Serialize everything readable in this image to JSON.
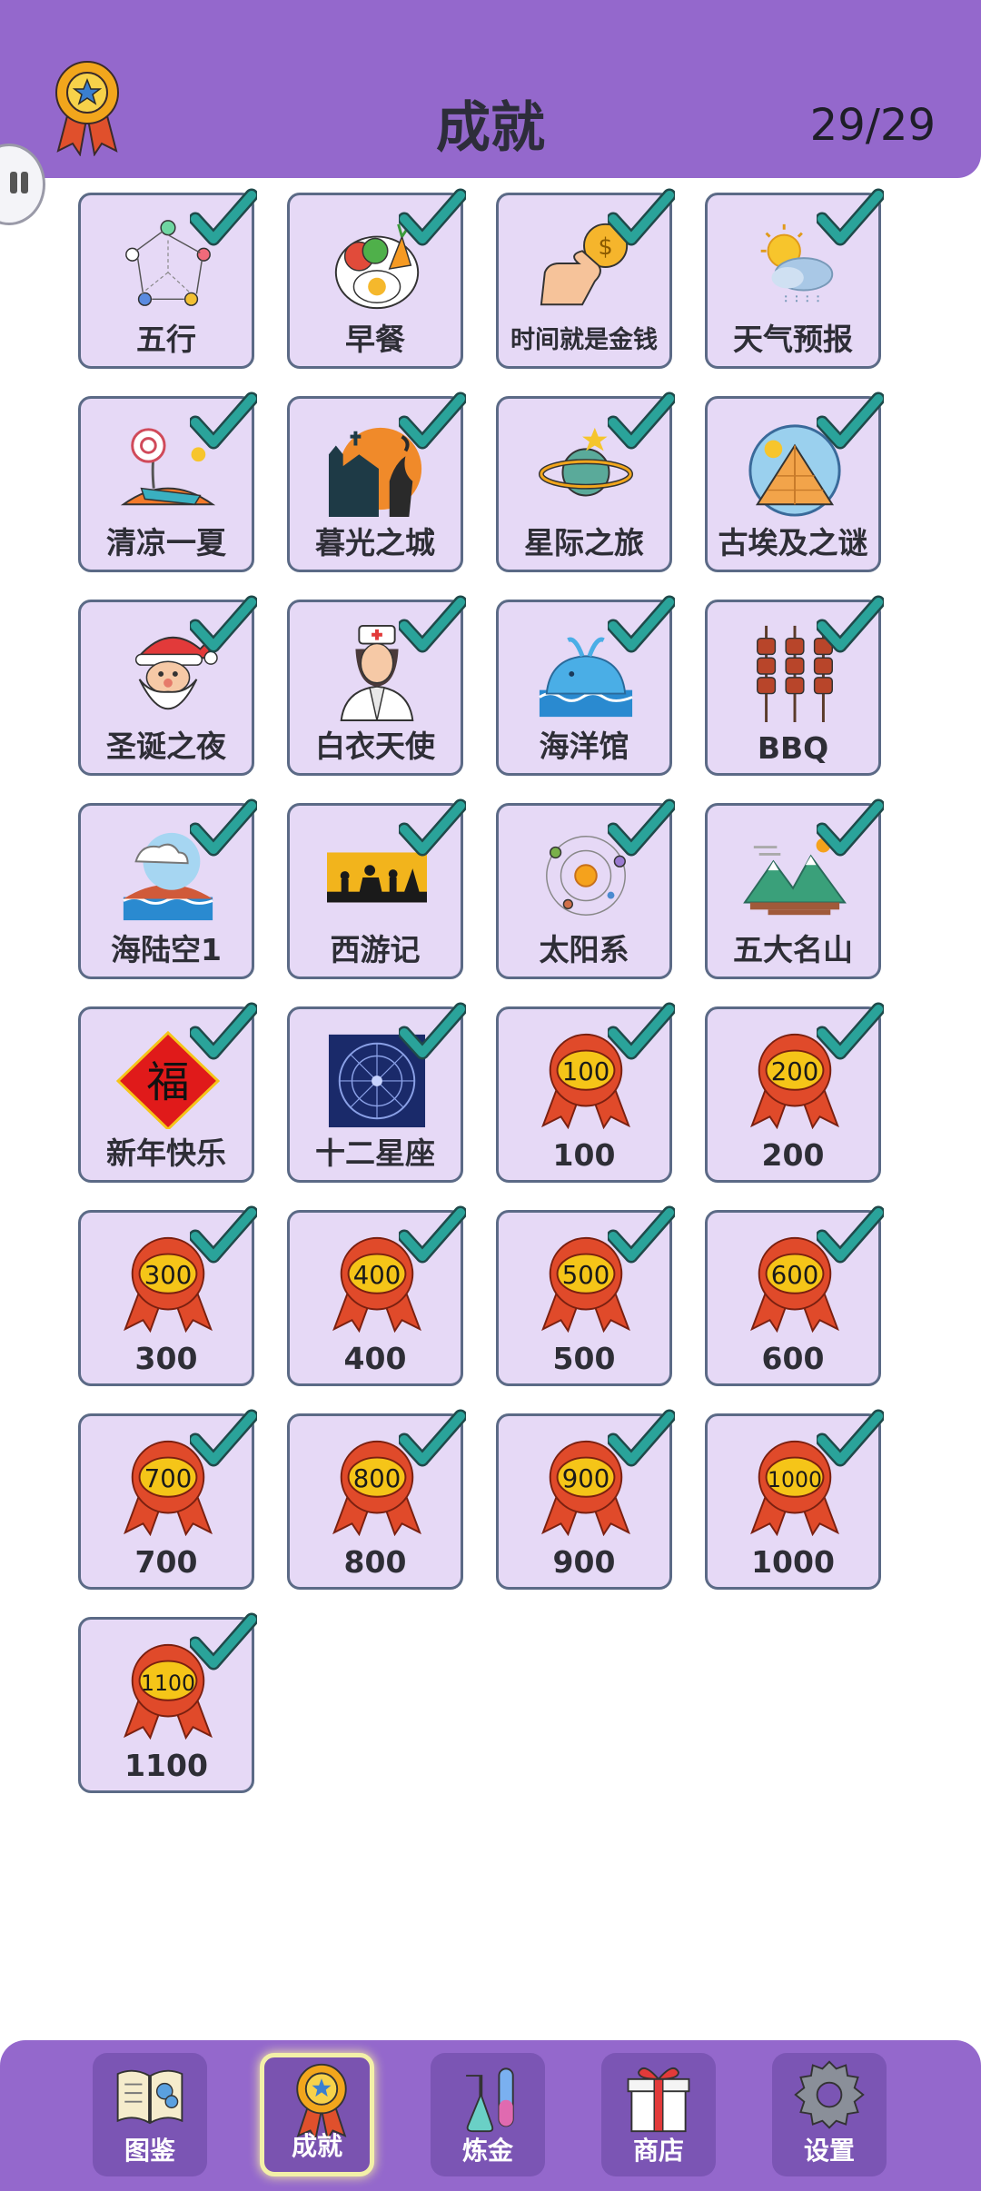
{
  "header": {
    "title": "成就",
    "count": "29/29"
  },
  "cards": [
    {
      "label": "五行"
    },
    {
      "label": "早餐"
    },
    {
      "label": "时间就是金钱"
    },
    {
      "label": "天气预报"
    },
    {
      "label": "清凉一夏"
    },
    {
      "label": "暮光之城"
    },
    {
      "label": "星际之旅"
    },
    {
      "label": "古埃及之谜"
    },
    {
      "label": "圣诞之夜"
    },
    {
      "label": "白衣天使"
    },
    {
      "label": "海洋馆"
    },
    {
      "label": "BBQ"
    },
    {
      "label": "海陆空1"
    },
    {
      "label": "西游记"
    },
    {
      "label": "太阳系"
    },
    {
      "label": "五大名山"
    },
    {
      "label": "新年快乐",
      "fu": "福"
    },
    {
      "label": "十二星座"
    },
    {
      "label": "100",
      "ribbon": "100"
    },
    {
      "label": "200",
      "ribbon": "200"
    },
    {
      "label": "300",
      "ribbon": "300"
    },
    {
      "label": "400",
      "ribbon": "400"
    },
    {
      "label": "500",
      "ribbon": "500"
    },
    {
      "label": "600",
      "ribbon": "600"
    },
    {
      "label": "700",
      "ribbon": "700"
    },
    {
      "label": "800",
      "ribbon": "800"
    },
    {
      "label": "900",
      "ribbon": "900"
    },
    {
      "label": "1000",
      "ribbon": "1000"
    },
    {
      "label": "1100",
      "ribbon": "1100"
    }
  ],
  "nav": [
    {
      "label": "图鉴",
      "icon": "book-icon"
    },
    {
      "label": "成就",
      "icon": "medal-icon",
      "active": true
    },
    {
      "label": "炼金",
      "icon": "flask-icon"
    },
    {
      "label": "商店",
      "icon": "gift-icon"
    },
    {
      "label": "设置",
      "icon": "gear-icon"
    }
  ],
  "colors": {
    "accent": "#9468cc",
    "card": "#e6d9f6",
    "check": "#2aa39a",
    "ribbon": "#e04a2a",
    "coin": "#f5c518"
  }
}
